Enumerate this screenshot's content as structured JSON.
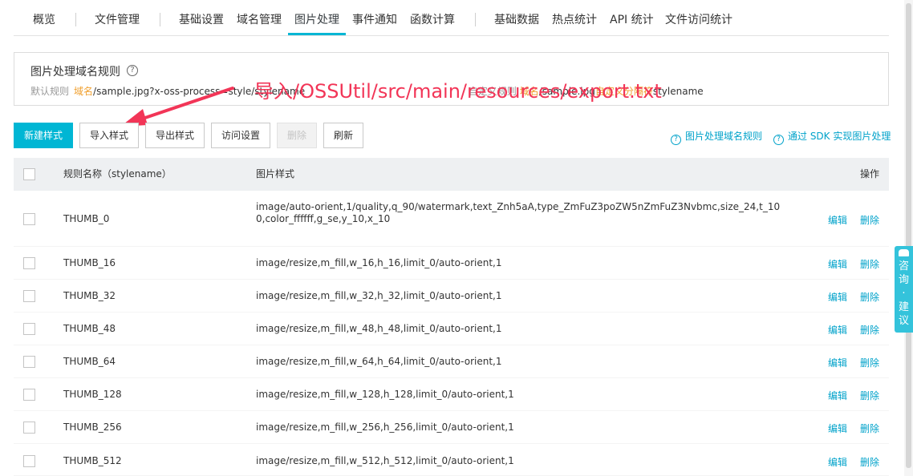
{
  "tabs": [
    {
      "label": "概览"
    },
    {
      "label": "文件管理"
    },
    {
      "label": "基础设置"
    },
    {
      "label": "域名管理"
    },
    {
      "label": "图片处理"
    },
    {
      "label": "事件通知"
    },
    {
      "label": "函数计算"
    },
    {
      "label": "基础数据"
    },
    {
      "label": "热点统计"
    },
    {
      "label": "API 统计"
    },
    {
      "label": "文件访问统计"
    }
  ],
  "active_tab": "图片处理",
  "rule_box": {
    "title": "图片处理域名规则",
    "prefix": "默认规则",
    "domain": "域名",
    "path": "/sample.jpg?x-oss-process=style/stylename",
    "hidden_left": "自定义规则",
    "hidden_domain": "域名",
    "hidden_path": "/sample.jpg",
    "hidden_sep": "自定义分隔符",
    "tail": "stylename"
  },
  "annotation_text": "导入/OSSUtil/src/main/resources/export.txt",
  "toolbar": {
    "new_style": "新建样式",
    "import_style": "导入样式",
    "export_style": "导出样式",
    "access_settings": "访问设置",
    "delete": "删除",
    "refresh": "刷新"
  },
  "help_links": {
    "domain_rules": "图片处理域名规则",
    "sdk": "通过 SDK 实现图片处理"
  },
  "table": {
    "headers": {
      "name": "规则名称（stylename）",
      "style": "图片样式",
      "actions": "操作"
    },
    "edit_label": "编辑",
    "delete_label": "删除",
    "rows": [
      {
        "name": "THUMB_0",
        "style": "image/auto-orient,1/quality,q_90/watermark,text_Znh5aA,type_ZmFuZ3poZW5nZmFuZ3Nvbmc,size_24,t_100,color_ffffff,g_se,y_10,x_10"
      },
      {
        "name": "THUMB_16",
        "style": "image/resize,m_fill,w_16,h_16,limit_0/auto-orient,1"
      },
      {
        "name": "THUMB_32",
        "style": "image/resize,m_fill,w_32,h_32,limit_0/auto-orient,1"
      },
      {
        "name": "THUMB_48",
        "style": "image/resize,m_fill,w_48,h_48,limit_0/auto-orient,1"
      },
      {
        "name": "THUMB_64",
        "style": "image/resize,m_fill,w_64,h_64,limit_0/auto-orient,1"
      },
      {
        "name": "THUMB_128",
        "style": "image/resize,m_fill,w_128,h_128,limit_0/auto-orient,1"
      },
      {
        "name": "THUMB_256",
        "style": "image/resize,m_fill,w_256,h_256,limit_0/auto-orient,1"
      },
      {
        "name": "THUMB_512",
        "style": "image/resize,m_fill,w_512,h_512,limit_0/auto-orient,1"
      }
    ]
  },
  "consult": {
    "chars": [
      "咨",
      "询",
      "·",
      "建",
      "议"
    ]
  },
  "colors": {
    "accent": "#00b6d4",
    "link": "#00a2ca",
    "annotation": "#f23557",
    "warning": "#f0a02f"
  }
}
